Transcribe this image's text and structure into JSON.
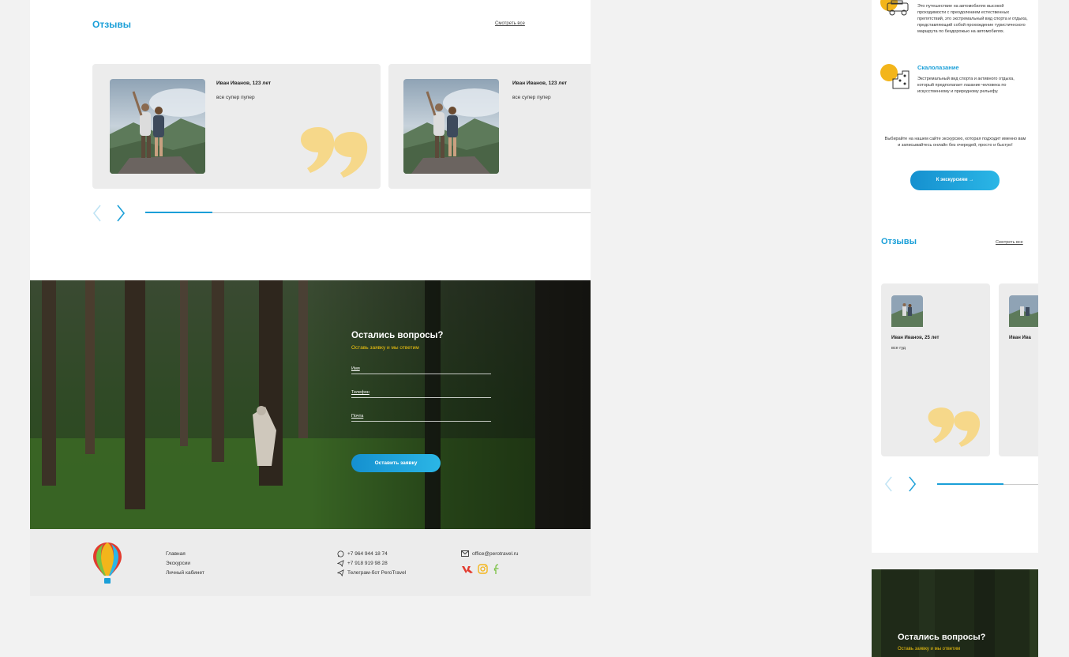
{
  "colors": {
    "accent": "#1a9fd8",
    "yellow": "#f1c40f",
    "quote": "#f6d88a",
    "card_bg": "#ececec"
  },
  "desktop": {
    "reviews": {
      "title": "Отзывы",
      "see_all": "Смотреть все",
      "cards": [
        {
          "name": "Иван Иванов, 123 лет",
          "text": "все супер пупер"
        },
        {
          "name": "Иван Иванов, 123 лет",
          "text": "все супер пупер"
        }
      ],
      "progress": 0.15
    },
    "form": {
      "title": "Остались вопросы?",
      "subtitle": "Оставь заявку и мы ответим",
      "fields": {
        "name": "Имя",
        "phone": "Телефон",
        "email": "Почта"
      },
      "submit": "Оставить заявку"
    },
    "footer": {
      "nav": [
        "Главная",
        "Экскурсии",
        "Личный кабинет"
      ],
      "phone1": "+7 964 944 18 74",
      "phone2": "+7 918 919 98 28",
      "telegram": "Телеграм-бот PeroTravel",
      "email": "office@perotravel.ru",
      "social_icons": [
        "vk-icon",
        "instagram-icon",
        "facebook-icon"
      ]
    }
  },
  "mobile": {
    "offroad_text": "Это путешествие на автомобилях высокой проходимости с преодолением естественных препятствий, это экстремальный вид спорта и отдыха, представляющий собой прохождение туристического маршрута по бездорожью на автомобилях.",
    "climbing_title": "Скалолазание",
    "climbing_text": "Экстремальный вид спорта и активного отдыха, который предполагает лазание человека по искусственному и природному рельефу.",
    "promo_text": "Выбирайте на нашем сайте экскурсию, которая подходит именно вам и записывайтесь онлайн без очередей, просто и быстро!",
    "tours_button": "К экскурсиям →",
    "reviews_title": "Отзывы",
    "see_all": "Смотреть все",
    "cards": [
      {
        "name": "Иван Иванов, 25 лет",
        "text": "все гуд"
      },
      {
        "name": "Иван Ива",
        "text": ""
      }
    ],
    "form_title": "Остались вопросы?",
    "form_subtitle": "Оставь заявку и мы ответим"
  }
}
